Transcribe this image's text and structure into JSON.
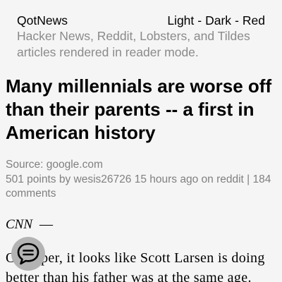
{
  "header": {
    "brand": "QotNews",
    "themes": [
      "Light",
      "Dark",
      "Red"
    ],
    "separator": "-",
    "tagline": "Hacker News, Reddit, Lobsters, and Tildes articles rendered in reader mode."
  },
  "article": {
    "title": "Many millennials are worse off than their parents -- a first in American history",
    "source_prefix": "Source: ",
    "source": "google.com",
    "points": "501 points by",
    "author": "wesis26726",
    "time": "15 hours ago on",
    "site": "reddit",
    "pipe": "|",
    "comments": "184 comments",
    "byline": "CNN",
    "byline_dash": "—",
    "body": "On paper, it looks like Scott Larsen is doing better than his father was at the same age."
  },
  "fab": {
    "icon": "comments-bubble-icon"
  },
  "colors": {
    "background": "#f5f5f5",
    "muted": "#808080",
    "fab": "#b3b3b3"
  }
}
